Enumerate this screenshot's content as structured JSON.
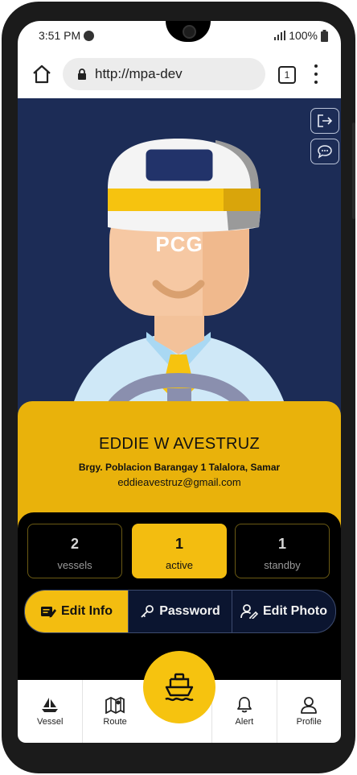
{
  "status_bar": {
    "time": "3:51 PM",
    "battery": "100%"
  },
  "browser": {
    "url": "http://mpa-dev",
    "tab_count": "1"
  },
  "hero": {
    "cap_badge": "PCG"
  },
  "profile": {
    "name": "EDDIE W AVESTRUZ",
    "address": "Brgy. Poblacion Barangay 1 Talalora, Samar",
    "email": "eddieavestruz@gmail.com"
  },
  "stats": [
    {
      "value": "2",
      "label": "vessels"
    },
    {
      "value": "1",
      "label": "active"
    },
    {
      "value": "1",
      "label": "standby"
    }
  ],
  "actions": {
    "edit_info": "Edit Info",
    "password": "Password",
    "edit_photo": "Edit Photo"
  },
  "nav": {
    "vessel": "Vessel",
    "route": "Route",
    "alert": "Alert",
    "profile": "Profile"
  },
  "colors": {
    "accent": "#f3bd10",
    "hero_bg": "#1c2c56",
    "panel_bg": "#000000"
  }
}
